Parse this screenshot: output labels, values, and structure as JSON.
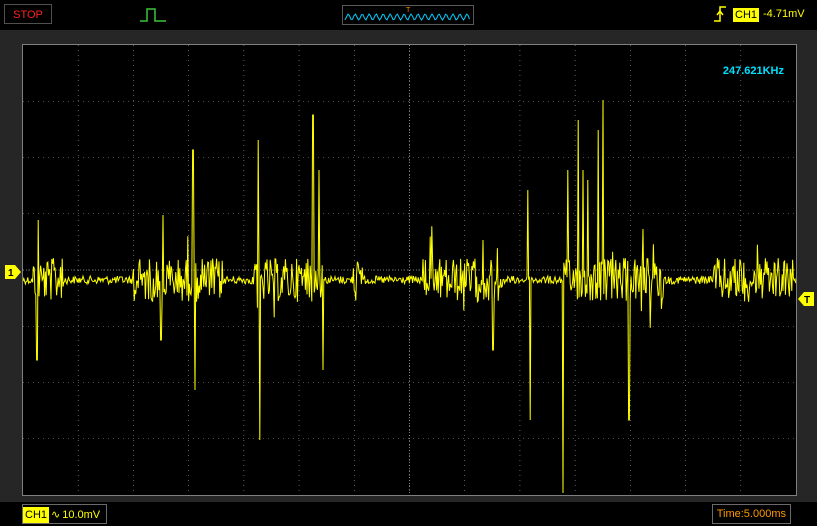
{
  "toolbar": {
    "run_state_label": "STOP",
    "trigger_source": "CH1",
    "trigger_level": "-4.71mV",
    "buffer_trigger_marker": "T",
    "icons": {
      "pulse": "pulse-icon",
      "edge": "rising-edge-icon"
    }
  },
  "display": {
    "frequency_readout": "247.621KHz",
    "channel_marker": "1",
    "trigger_marker": "T",
    "trace_color": "#ffff00",
    "grid_divisions": {
      "horizontal": 14,
      "vertical": 8
    }
  },
  "status": {
    "channel_label": "CH1",
    "coupling_symbol": "∿",
    "volts_per_div": "10.0mV",
    "timebase": "Time:5.000ms"
  },
  "colors": {
    "background": "#000000",
    "grid": "#9a9a9a",
    "trace": "#ffff00",
    "stop": "#ff2020",
    "frequency": "#00e0ff",
    "timebase": "#ff9900"
  }
}
